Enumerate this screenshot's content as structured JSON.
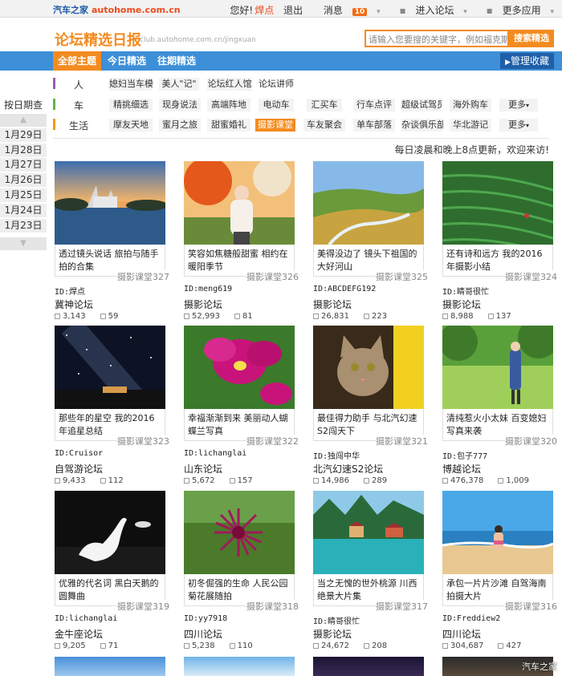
{
  "topbar": {
    "logo": "汽车之家",
    "domain": "autohome.com.cn",
    "greeting": "您好!",
    "user": "焊点",
    "logout": "退出",
    "messages": "消息",
    "msg_count": "10",
    "forum_entry": "进入论坛",
    "more_apps": "更多应用"
  },
  "header": {
    "title": "论坛精选日报",
    "url": "club.autohome.com.cn/jingxuan",
    "search_placeholder": "请输入您要搜的关键字，例如福克斯",
    "search_button": "搜索精选"
  },
  "nav": {
    "tabs": [
      "全部主题",
      "今日精选",
      "往期精选"
    ],
    "manage": "管理收藏"
  },
  "categories": [
    {
      "label": "人",
      "color": "#9b59b6",
      "tags": [
        "媳妇当车模",
        "美人\"记\"",
        "论坛红人馆",
        "论坛讲师"
      ]
    },
    {
      "label": "车",
      "color": "#6ab04c",
      "tags": [
        "精挑细选",
        "现身说法",
        "高端阵地",
        "电动车",
        "汇买车",
        "行车点评",
        "超级试驾员",
        "海外购车",
        "更多"
      ]
    },
    {
      "label": "生活",
      "color": "#f39c12",
      "tags": [
        "摩友天地",
        "蜜月之旅",
        "甜蜜婚礼",
        "摄影课堂",
        "车友聚会",
        "单车部落",
        "杂谈俱乐部",
        "华北游记",
        "更多"
      ]
    }
  ],
  "dates": {
    "header": "按日期查看",
    "items": [
      "1月29日",
      "1月28日",
      "1月27日",
      "1月26日",
      "1月25日",
      "1月24日",
      "1月23日"
    ]
  },
  "notice": "每日凌晨和晚上8点更新，欢迎来访!",
  "cards": [
    {
      "title": "透过镜头说话 旅拍与随手拍的合集",
      "count": "摄影课堂327",
      "id": "ID:焊点",
      "forum": "冀神论坛",
      "views": "3,143",
      "replies": "59",
      "img": "castle"
    },
    {
      "title": "笑容如焦糖般甜蜜 相约在暖阳季节",
      "count": "摄影课堂326",
      "id": "ID:meng619",
      "forum": "摄影论坛",
      "views": "52,993",
      "replies": "81",
      "img": "girl-autumn"
    },
    {
      "title": "美得没边了 镜头下祖国的大好河山",
      "count": "摄影课堂325",
      "id": "ID:ABCDEFG192",
      "forum": "摄影论坛",
      "views": "26,831",
      "replies": "223",
      "img": "river-valley"
    },
    {
      "title": "还有诗和远方 我的2016年摄影小结",
      "count": "摄影课堂324",
      "id": "ID:睛哥很忙",
      "forum": "摄影论坛",
      "views": "8,988",
      "replies": "137",
      "img": "tea-field"
    },
    {
      "title": "那些年的星空 我的2016年追星总结",
      "count": "摄影课堂323",
      "id": "ID:Cruisor",
      "forum": "自驾游论坛",
      "views": "9,433",
      "replies": "112",
      "img": "starry-sky"
    },
    {
      "title": "幸福渐渐到来 美丽动人蝴蝶兰写真",
      "count": "摄影课堂322",
      "id": "ID:lichanglai",
      "forum": "山东论坛",
      "views": "5,672",
      "replies": "157",
      "img": "orchid"
    },
    {
      "title": "最佳得力助手 与北汽幻速S2闯天下",
      "count": "摄影课堂321",
      "id": "ID:独闯中华",
      "forum": "北汽幻速S2论坛",
      "views": "14,986",
      "replies": "289",
      "img": "cat"
    },
    {
      "title": "清纯惹火小太妹 百变媳妇写真来袭",
      "count": "摄影课堂320",
      "id": "ID:包子777",
      "forum": "博越论坛",
      "views": "476,378",
      "replies": "1,009",
      "img": "girl-meadow"
    },
    {
      "title": "优雅的代名词 黑白天鹅的圆舞曲",
      "count": "摄影课堂319",
      "id": "ID:lichanglai",
      "forum": "金牛座论坛",
      "views": "9,205",
      "replies": "71",
      "img": "swan"
    },
    {
      "title": "初冬倔强的生命 人民公园菊花展随拍",
      "count": "摄影课堂318",
      "id": "ID:yy7918",
      "forum": "四川论坛",
      "views": "5,238",
      "replies": "110",
      "img": "chrysanthemum"
    },
    {
      "title": "当之无愧的世外桃源 川西绝景大片集",
      "count": "摄影课堂317",
      "id": "ID:睛哥很忙",
      "forum": "摄影论坛",
      "views": "24,672",
      "replies": "208",
      "img": "lake-village"
    },
    {
      "title": "承包一片片沙滩 自驾海南拍摄大片",
      "count": "摄影课堂316",
      "id": "ID:Freddiew2",
      "forum": "四川论坛",
      "views": "304,687",
      "replies": "427",
      "img": "beach"
    }
  ],
  "footer_watermark": "汽车之家"
}
